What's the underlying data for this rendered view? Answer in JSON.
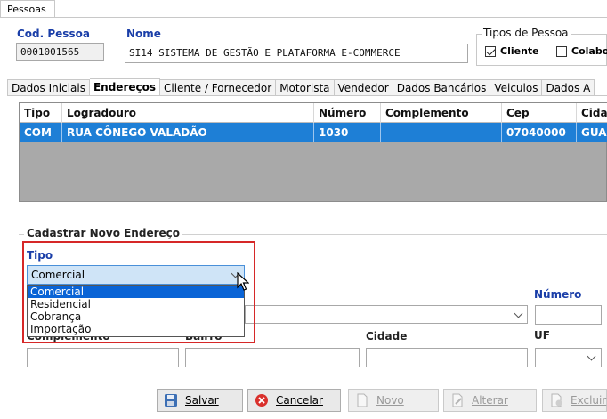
{
  "window": {
    "top_tab": "Pessoas"
  },
  "header": {
    "cod_label": "Cod. Pessoa",
    "cod_value": "0001001565",
    "nome_label": "Nome",
    "nome_value": "SI14 SISTEMA DE GESTÃO E PLATAFORMA E-COMMERCE",
    "tipos_label": "Tipos de Pessoa",
    "tipos": [
      {
        "label": "Cliente",
        "checked": true
      },
      {
        "label": "Colabo",
        "checked": false
      }
    ]
  },
  "tabs": [
    {
      "label": "Dados Iniciais",
      "active": false
    },
    {
      "label": "Endereços",
      "active": true
    },
    {
      "label": "Cliente / Fornecedor",
      "active": false
    },
    {
      "label": "Motorista",
      "active": false
    },
    {
      "label": "Vendedor",
      "active": false
    },
    {
      "label": "Dados Bancários",
      "active": false
    },
    {
      "label": "Veiculos",
      "active": false
    },
    {
      "label": "Dados A",
      "active": false
    }
  ],
  "grid": {
    "columns": [
      "Tipo",
      "Logradouro",
      "Número",
      "Complemento",
      "Cep",
      "Cidad"
    ],
    "rows": [
      [
        "COM",
        "RUA CÔNEGO VALADÃO",
        "1030",
        "",
        "07040000",
        "GUAR"
      ]
    ]
  },
  "form": {
    "section_title": "Cadastrar Novo Endereço",
    "tipo_label": "Tipo",
    "tipo_selected": "Comercial",
    "tipo_options": [
      "Comercial",
      "Residencial",
      "Cobrança",
      "Importação"
    ],
    "numero_label": "Número",
    "complemento_label": "Complemento",
    "bairro_label": "Bairro",
    "cidade_label": "Cidade",
    "uf_label": "UF"
  },
  "buttons": {
    "salvar": "Salvar",
    "cancelar": "Cancelar",
    "novo": "Novo",
    "alterar": "Alterar",
    "excluir": "Excluir"
  }
}
